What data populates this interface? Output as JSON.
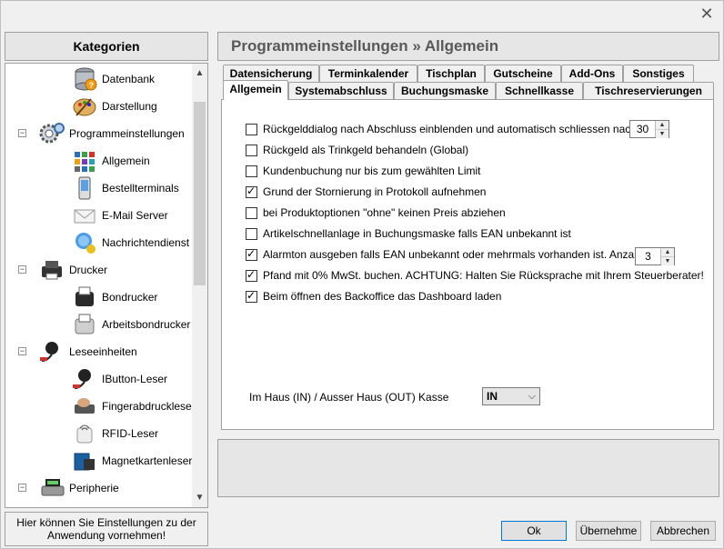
{
  "window": {
    "close_label": "✕"
  },
  "sidebar": {
    "header": "Kategorien",
    "items": [
      {
        "label": "Datenbank",
        "level": 2,
        "icon": "database-icon"
      },
      {
        "label": "Darstellung",
        "level": 2,
        "icon": "palette-icon"
      },
      {
        "label": "Programmeinstellungen",
        "level": 1,
        "icon": "gears-icon",
        "expander": "−"
      },
      {
        "label": "Allgemein",
        "level": 2,
        "icon": "grid-icon"
      },
      {
        "label": "Bestellterminals",
        "level": 2,
        "icon": "mobile-terminal-icon"
      },
      {
        "label": "E-Mail Server",
        "level": 2,
        "icon": "envelope-icon"
      },
      {
        "label": "Nachrichtendienst",
        "level": 2,
        "icon": "messenger-icon"
      },
      {
        "label": "Drucker",
        "level": 1,
        "icon": "printer-icon",
        "expander": "−"
      },
      {
        "label": "Bondrucker",
        "level": 2,
        "icon": "receipt-printer-icon"
      },
      {
        "label": "Arbeitsbondrucker",
        "level": 2,
        "icon": "work-printer-icon"
      },
      {
        "label": "Leseeinheiten",
        "level": 1,
        "icon": "ibutton-reader-icon",
        "expander": "−"
      },
      {
        "label": "IButton-Leser",
        "level": 2,
        "icon": "ibutton-icon"
      },
      {
        "label": "Fingerabdruckleser",
        "level": 2,
        "icon": "fingerprint-icon"
      },
      {
        "label": "RFID-Leser",
        "level": 2,
        "icon": "rfid-icon"
      },
      {
        "label": "Magnetkartenleser",
        "level": 2,
        "icon": "magnetic-card-icon"
      },
      {
        "label": "Peripherie",
        "level": 1,
        "icon": "peripheral-icon",
        "expander": "−"
      }
    ],
    "hint": "Hier können Sie Einstellungen zu der Anwendung vornehmen!"
  },
  "main": {
    "title": "Programmeinstellungen » Allgemein",
    "tabs_row1": [
      "Datensicherung",
      "Terminkalender",
      "Tischplan",
      "Gutscheine",
      "Add-Ons",
      "Sonstiges"
    ],
    "tabs_row2": [
      "Allgemein",
      "Systemabschluss",
      "Buchungsmaske",
      "Schnellkasse",
      "Tischreservierungen"
    ],
    "active_tab": "Allgemein",
    "options": [
      {
        "label": "Rückgelddialog nach Abschluss einblenden und automatisch schliessen nach :",
        "checked": false
      },
      {
        "label": "Rückgeld als Trinkgeld behandeln (Global)",
        "checked": false
      },
      {
        "label": "Kundenbuchung nur bis zum gewählten Limit",
        "checked": false
      },
      {
        "label": "Grund der Stornierung in Protokoll aufnehmen",
        "checked": true
      },
      {
        "label": "bei Produktoptionen \"ohne\" keinen Preis  abziehen",
        "checked": false
      },
      {
        "label": "Artikelschnellanlage in Buchungsmaske falls EAN unbekannt ist",
        "checked": false
      },
      {
        "label": "Alarmton ausgeben falls EAN unbekannt oder mehrmals vorhanden ist. Anzahl Töne:",
        "checked": true
      },
      {
        "label": "Pfand mit 0% MwSt. buchen. ACHTUNG: Halten Sie Rücksprache mit Ihrem Steuerberater!",
        "checked": true
      },
      {
        "label": "Beim öffnen des Backoffice das Dashboard laden",
        "checked": true
      }
    ],
    "close_seconds": "30",
    "alarm_count": "3",
    "haus_label": "Im Haus (IN) / Ausser Haus (OUT) Kasse",
    "haus_value": "IN"
  },
  "footer": {
    "ok": "Ok",
    "apply": "Übernehme",
    "cancel": "Abbrechen"
  }
}
